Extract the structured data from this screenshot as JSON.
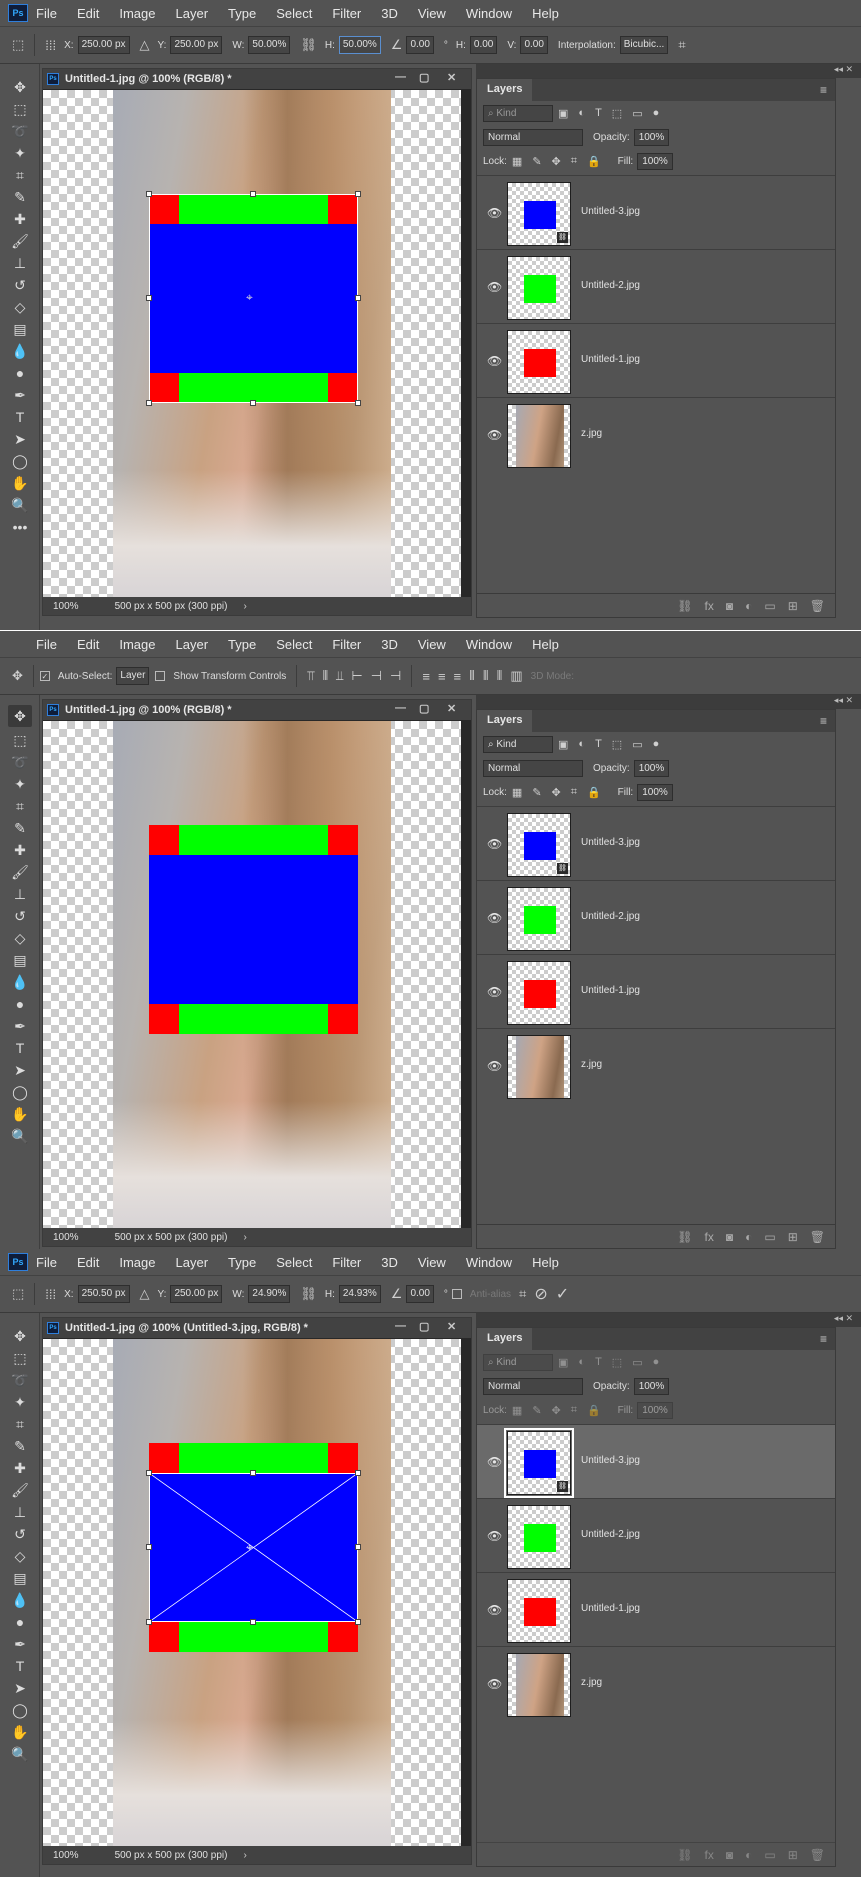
{
  "menu": [
    "File",
    "Edit",
    "Image",
    "Layer",
    "Type",
    "Select",
    "Filter",
    "3D",
    "View",
    "Window",
    "Help"
  ],
  "ps_logo": "Ps",
  "panel_tab": "Layers",
  "kind_label": "Kind",
  "blend_mode": "Normal",
  "opacity_label": "Opacity:",
  "opacity_value": "100%",
  "lock_label": "Lock:",
  "fill_label": "Fill:",
  "fill_value": "100%",
  "zoom": "100%",
  "doc_size": "500 px x 500 px (300 ppi)",
  "layers": [
    {
      "name": "Untitled-3.jpg",
      "swatch": "#0000ff",
      "linked": true
    },
    {
      "name": "Untitled-2.jpg",
      "swatch": "#00ff00",
      "linked": false
    },
    {
      "name": "Untitled-1.jpg",
      "swatch": "#ff0000",
      "linked": false
    },
    {
      "name": "z.jpg",
      "swatch": "photo",
      "linked": false
    }
  ],
  "colors": {
    "red": "#ff0000",
    "green": "#00ff00",
    "blue": "#0000ff",
    "ui_bg": "#535353"
  },
  "screens": [
    {
      "doc_title": "Untitled-1.jpg @ 100% (RGB/8) *",
      "selected_layer": null,
      "options": {
        "x_label": "X:",
        "x": "250.00 px",
        "y_label": "Y:",
        "y": "250.00 px",
        "w_label": "W:",
        "w": "50.00%",
        "h_label": "H:",
        "h": "50.00%",
        "angle": "0.00",
        "deg": "°",
        "hskew_label": "H:",
        "hskew": "0.00",
        "vskew_label": "V:",
        "vskew": "0.00",
        "interp_label": "Interpolation:",
        "interp": "Bicubic..."
      }
    },
    {
      "doc_title": "Untitled-1.jpg @ 100% (RGB/8) *",
      "selected_layer": null,
      "options": {
        "auto_select_label": "Auto-Select:",
        "auto_select_target": "Layer",
        "show_transform_label": "Show Transform Controls",
        "mode_3d": "3D Mode:"
      }
    },
    {
      "doc_title": "Untitled-1.jpg @ 100% (Untitled-3.jpg, RGB/8) *",
      "selected_layer": 0,
      "options": {
        "x_label": "X:",
        "x": "250.50 px",
        "y_label": "Y:",
        "y": "250.00 px",
        "w_label": "W:",
        "w": "24.90%",
        "h_label": "H:",
        "h": "24.93%",
        "angle": "0.00",
        "deg": "°",
        "antialias": "Anti-alias"
      }
    }
  ]
}
